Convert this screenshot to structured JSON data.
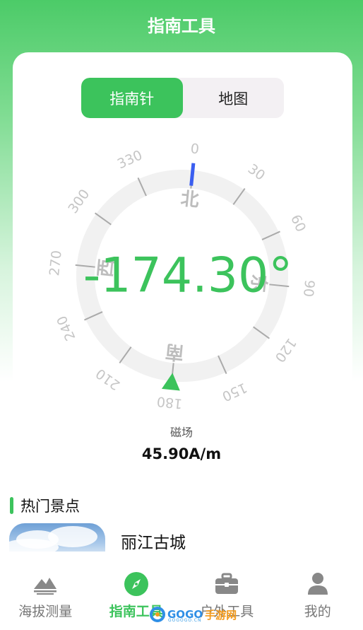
{
  "header": {
    "title": "指南工具"
  },
  "segments": {
    "compass": "指南针",
    "map": "地图"
  },
  "compass": {
    "heading_text": "-174.30°",
    "heading_deg": -174.3,
    "degree_labels": [
      "0",
      "30",
      "60",
      "90",
      "120",
      "150",
      "180",
      "210",
      "240",
      "270",
      "300",
      "330"
    ],
    "directions": {
      "north": "北",
      "south": "南",
      "east": "东",
      "west": "西"
    },
    "accent": "#3cc35c",
    "needle_color": "#3a5ef0"
  },
  "magnetic": {
    "label": "磁场",
    "value": "45.90A/m"
  },
  "hot_spots": {
    "title": "热门景点",
    "items": [
      {
        "name": "丽江古城"
      }
    ]
  },
  "tabbar": {
    "items": [
      {
        "label": "海拔测量",
        "icon": "mountain-icon"
      },
      {
        "label": "指南工具",
        "icon": "compass-icon"
      },
      {
        "label": "户外工具",
        "icon": "toolbox-icon"
      },
      {
        "label": "我的",
        "icon": "user-icon"
      }
    ]
  },
  "watermark": {
    "brand": "GOGO",
    "suffix": "手游网",
    "sub": "GOGOGO.CN"
  }
}
